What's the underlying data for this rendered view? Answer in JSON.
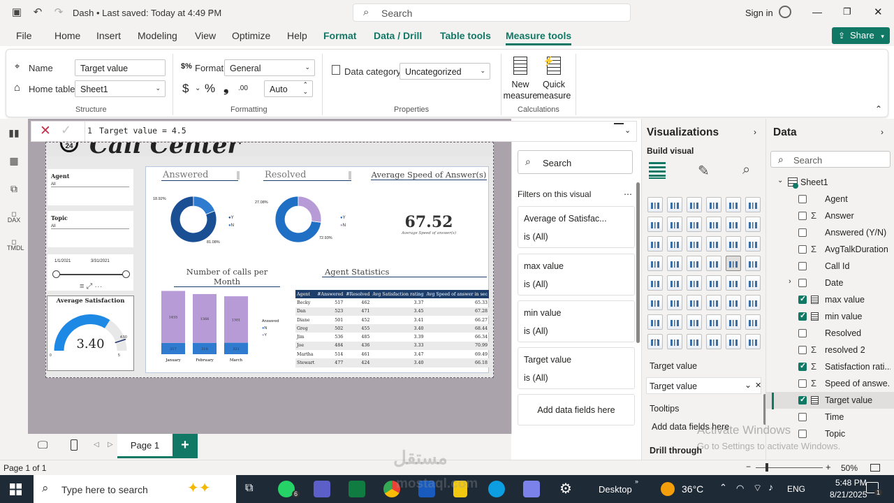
{
  "titlebar": {
    "doc_title": "Dash • Last saved: Today at 4:49 PM",
    "search_placeholder": "Search",
    "signin": "Sign in"
  },
  "menu": {
    "items": [
      "File",
      "Home",
      "Insert",
      "Modeling",
      "View",
      "Optimize",
      "Help",
      "Format",
      "Data / Drill",
      "Table tools",
      "Measure tools"
    ],
    "share": "Share"
  },
  "ribbon": {
    "name_label": "Name",
    "name_value": "Target value",
    "home_table_label": "Home table",
    "home_table_value": "Sheet1",
    "structure_label": "Structure",
    "format_label": "Format",
    "format_value": "General",
    "currency_symbol": "$",
    "percent_symbol": "%",
    "comma_symbol": "❟",
    "decimal_symbol": ".00",
    "auto_value": "Auto",
    "formatting_label": "Formatting",
    "data_category_label": "Data category",
    "data_category_value": "Uncategorized",
    "properties_label": "Properties",
    "new_measure": "New measure",
    "quick_measure": "Quick measure",
    "calculations_label": "Calculations"
  },
  "formula": {
    "line": "1",
    "text": "Target value = 4.5"
  },
  "report": {
    "title": "Call Center",
    "badge": "24",
    "slicers": [
      {
        "label": "Agent",
        "value": "All"
      },
      {
        "label": "Topic",
        "value": "All"
      }
    ],
    "date_from": "1/1/2021",
    "date_to": "3/31/2021",
    "gauge": {
      "title": "Average Satisfaction",
      "value": "3.40",
      "min": "0",
      "max": "5",
      "target": "4.50",
      "fraction": 0.68,
      "target_fraction": 0.9
    },
    "answered_title": "Answered",
    "resolved_title": "Resolved",
    "speed_title": "Average Speed of Answer(s)",
    "speed_value": "67.52",
    "speed_sub": "Average Speed of answer(s)",
    "answered_donut": {
      "slices": [
        {
          "label": "Y",
          "pct": "81.08%",
          "value": 0.8108,
          "color": "#1a4f93"
        },
        {
          "label": "N",
          "pct": "18.92%",
          "value": 0.1892,
          "color": "#2f7bd0"
        }
      ]
    },
    "resolved_donut": {
      "slices": [
        {
          "label": "Y",
          "pct": "72.93%",
          "value": 0.7293,
          "color": "#1f6fc5"
        },
        {
          "label": "N",
          "pct": "27.08%",
          "value": 0.2708,
          "color": "#b79bd6"
        }
      ]
    },
    "calls_title": "Number  of calls per Month",
    "agent_stats_title": "Agent Statistics",
    "chart_legend_title": "Answered",
    "chart_legend": [
      "N",
      "Y"
    ],
    "table_headers": [
      "Agent",
      "#Answered",
      "#Resolved",
      "Avg Satisfaction rating",
      "Avg Speed of answer in sec"
    ],
    "table_rows": [
      [
        "Becky",
        "517",
        "462",
        "3.37",
        "65.33"
      ],
      [
        "Dan",
        "523",
        "471",
        "3.45",
        "67.28"
      ],
      [
        "Diane",
        "501",
        "452",
        "3.41",
        "66.27"
      ],
      [
        "Greg",
        "502",
        "455",
        "3.40",
        "68.44"
      ],
      [
        "Jim",
        "536",
        "485",
        "3.39",
        "66.34"
      ],
      [
        "Joe",
        "484",
        "436",
        "3.33",
        "70.99"
      ],
      [
        "Martha",
        "514",
        "461",
        "3.47",
        "69.49"
      ],
      [
        "Stewart",
        "477",
        "424",
        "3.40",
        "66.18"
      ]
    ]
  },
  "chart_data": {
    "type": "bar",
    "title": "Number  of calls per Month",
    "categories": [
      "January",
      "February",
      "March"
    ],
    "series": [
      {
        "name": "N",
        "values": [
          317,
          318,
          321
        ]
      },
      {
        "name": "Y",
        "values": [
          1455,
          1366,
          1301
        ]
      }
    ],
    "stacked": true,
    "colors": {
      "N": "#2f7bd0",
      "Y": "#b79bd6"
    }
  },
  "filters": {
    "search_placeholder": "Search",
    "heading": "Filters on this visual",
    "cards": [
      {
        "title": "Average of Satisfac...",
        "state": "is (All)"
      },
      {
        "title": "max value",
        "state": "is (All)"
      },
      {
        "title": "min value",
        "state": "is (All)"
      },
      {
        "title": "Target value",
        "state": "is (All)"
      }
    ],
    "add_fields": "Add data fields here"
  },
  "viz": {
    "title": "Visualizations",
    "build": "Build visual",
    "target_section": "Target value",
    "target_field": "Target value",
    "tooltips": "Tooltips",
    "add_fields": "Add data fields here",
    "drill": "Drill through",
    "more": "..."
  },
  "data": {
    "title": "Data",
    "search_placeholder": "Search",
    "table": "Sheet1",
    "fields": [
      {
        "name": "Agent",
        "checked": false,
        "sigma": false
      },
      {
        "name": "Answer",
        "checked": false,
        "sigma": true
      },
      {
        "name": "Answered (Y/N)",
        "checked": false,
        "sigma": false
      },
      {
        "name": "AvgTalkDuration",
        "checked": false,
        "sigma": true
      },
      {
        "name": "Call Id",
        "checked": false,
        "sigma": false
      },
      {
        "name": "Date",
        "checked": false,
        "sigma": false
      },
      {
        "name": "max value",
        "checked": true,
        "sigma": false
      },
      {
        "name": "min value",
        "checked": true,
        "sigma": false
      },
      {
        "name": "Resolved",
        "checked": false,
        "sigma": false
      },
      {
        "name": "resolved 2",
        "checked": false,
        "sigma": true
      },
      {
        "name": "Satisfaction rati...",
        "checked": true,
        "sigma": true
      },
      {
        "name": "Speed of answe...",
        "checked": false,
        "sigma": true
      },
      {
        "name": "Target value",
        "checked": true,
        "sigma": false
      },
      {
        "name": "Time",
        "checked": false,
        "sigma": false
      },
      {
        "name": "Topic",
        "checked": false,
        "sigma": false
      }
    ]
  },
  "pages": {
    "current": "Page 1",
    "status": "Page 1 of 1",
    "zoom": "50%"
  },
  "watermark": {
    "line1": "Activate Windows",
    "line2": "Go to Settings to activate Windows.",
    "logo": "مستقل",
    "logo_sub": "mostaql.com"
  },
  "taskbar": {
    "search": "Type here to search",
    "desktop": "Desktop",
    "temp": "36°C",
    "lang": "ENG",
    "time": "5:48 PM",
    "date": "8/21/2025",
    "whatsapp_badge": "6",
    "notif": "1"
  }
}
